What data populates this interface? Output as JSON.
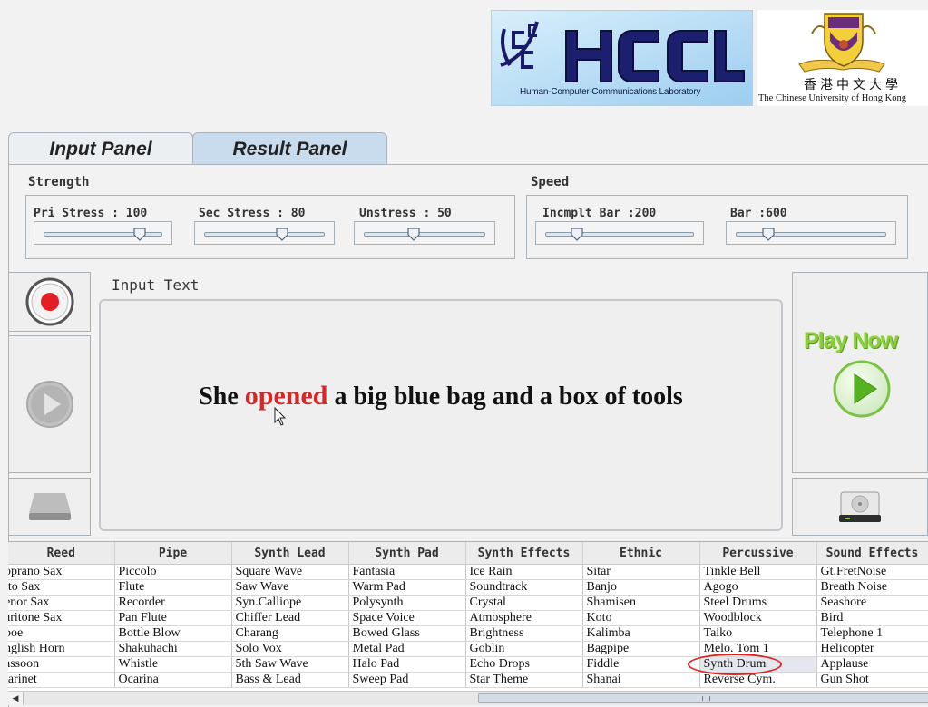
{
  "header": {
    "hccl_logo_text": "HCCL",
    "hccl_lab_name": "Human-Computer Communications Laboratory",
    "cuhk_chinese_name": "香港中文大學",
    "cuhk_english_name": "The Chinese University of Hong Kong"
  },
  "tabs": [
    {
      "label": "Input Panel",
      "active": false
    },
    {
      "label": "Result Panel",
      "active": true
    }
  ],
  "strength": {
    "title": "Strength",
    "sliders": [
      {
        "label": "Pri Stress : 100",
        "value": 100,
        "max": 120
      },
      {
        "label": "Sec Stress : 80",
        "value": 80,
        "max": 120
      },
      {
        "label": "Unstress : 50",
        "value": 50,
        "max": 120
      }
    ]
  },
  "speed": {
    "title": "Speed",
    "sliders": [
      {
        "label": "Incmplt Bar :200",
        "value": 200,
        "max": 900
      },
      {
        "label": "Bar :600",
        "value": 600,
        "max": 2400
      }
    ]
  },
  "input": {
    "label": "Input Text",
    "sentence_before": "She ",
    "stressed_word": "opened",
    "sentence_after": " a big blue bag and a box of tools"
  },
  "play_now": {
    "label": "Play Now"
  },
  "colors": {
    "tab_active": "#c9dcee",
    "stressed_word": "#d82525",
    "play_green": "#8ccf3e",
    "selection_ring": "#dd2222"
  },
  "instrument_table": {
    "columns": [
      "Reed",
      "Pipe",
      "Synth Lead",
      "Synth Pad",
      "Synth Effects",
      "Ethnic",
      "Percussive",
      "Sound Effects"
    ],
    "rows": [
      [
        "oprano Sax",
        "Piccolo",
        "Square Wave",
        "Fantasia",
        "Ice Rain",
        "Sitar",
        "Tinkle Bell",
        "Gt.FretNoise"
      ],
      [
        "lto Sax",
        "Flute",
        "Saw Wave",
        "Warm Pad",
        "Soundtrack",
        "Banjo",
        "Agogo",
        "Breath Noise"
      ],
      [
        "enor Sax",
        "Recorder",
        "Syn.Calliope",
        "Polysynth",
        "Crystal",
        "Shamisen",
        "Steel Drums",
        "Seashore"
      ],
      [
        "aritone Sax",
        "Pan Flute",
        "Chiffer Lead",
        "Space Voice",
        "Atmosphere",
        "Koto",
        "Woodblock",
        "Bird"
      ],
      [
        "boe",
        "Bottle Blow",
        "Charang",
        "Bowed Glass",
        "Brightness",
        "Kalimba",
        "Taiko",
        "Telephone 1"
      ],
      [
        "nglish Horn",
        "Shakuhachi",
        "Solo Vox",
        "Metal Pad",
        "Goblin",
        "Bagpipe",
        "Melo. Tom 1",
        "Helicopter"
      ],
      [
        "assoon",
        "Whistle",
        "5th Saw Wave",
        "Halo Pad",
        "Echo Drops",
        "Fiddle",
        "Synth Drum",
        "Applause"
      ],
      [
        "larinet",
        "Ocarina",
        "Bass & Lead",
        "Sweep Pad",
        "Star Theme",
        "Shanai",
        "Reverse Cym.",
        "Gun Shot"
      ]
    ],
    "selected": {
      "row": 6,
      "col": 6
    }
  }
}
